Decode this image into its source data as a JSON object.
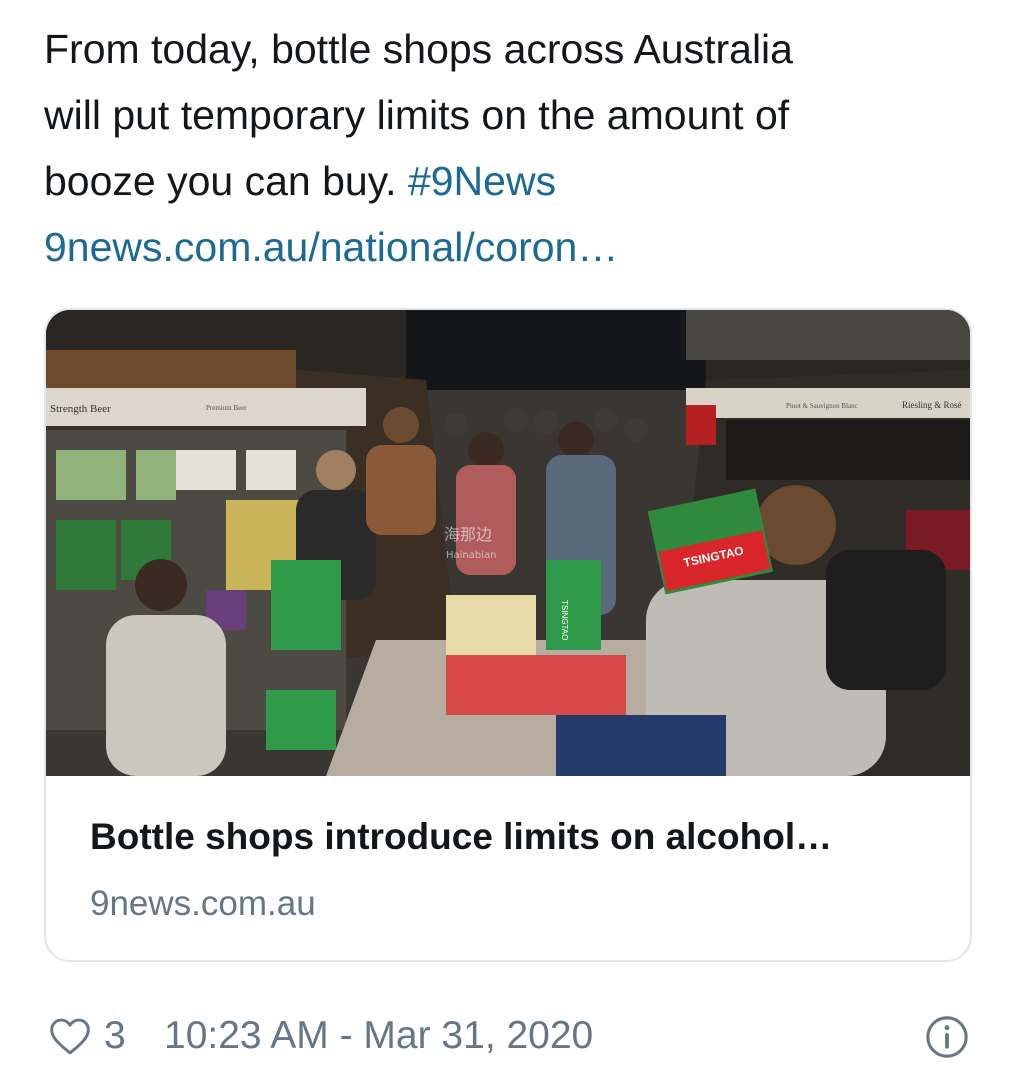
{
  "tweet": {
    "text_line_1": "From today, bottle shops across Australia",
    "text_line_2": "will put temporary limits on the amount of",
    "text_line_3": "booze you can buy.",
    "hashtag": "#9News",
    "link": "9news.com.au/national/coron…"
  },
  "card": {
    "title": "Bottle shops introduce limits on alcohol…",
    "domain": "9news.com.au",
    "image": {
      "sign_left": "Strength Beer",
      "sign_left_2": "Premium Beer",
      "sign_right": "Riesling & Rosé",
      "sign_right_2": "Pinot & Sauvignon Blanc",
      "box_label": "TSINGTAO",
      "box_label_2": "TSINGTAO",
      "watermark": "海那边",
      "watermark_2": "Hainabian"
    }
  },
  "footer": {
    "like_icon": "heart-outline-icon",
    "like_count": "3",
    "timestamp": "10:23 AM - Mar 31, 2020",
    "info_icon": "info-circle-icon"
  },
  "colors": {
    "text": "#14171a",
    "link": "#1b6a96",
    "muted": "#657786",
    "border": "#e1e8ed"
  }
}
